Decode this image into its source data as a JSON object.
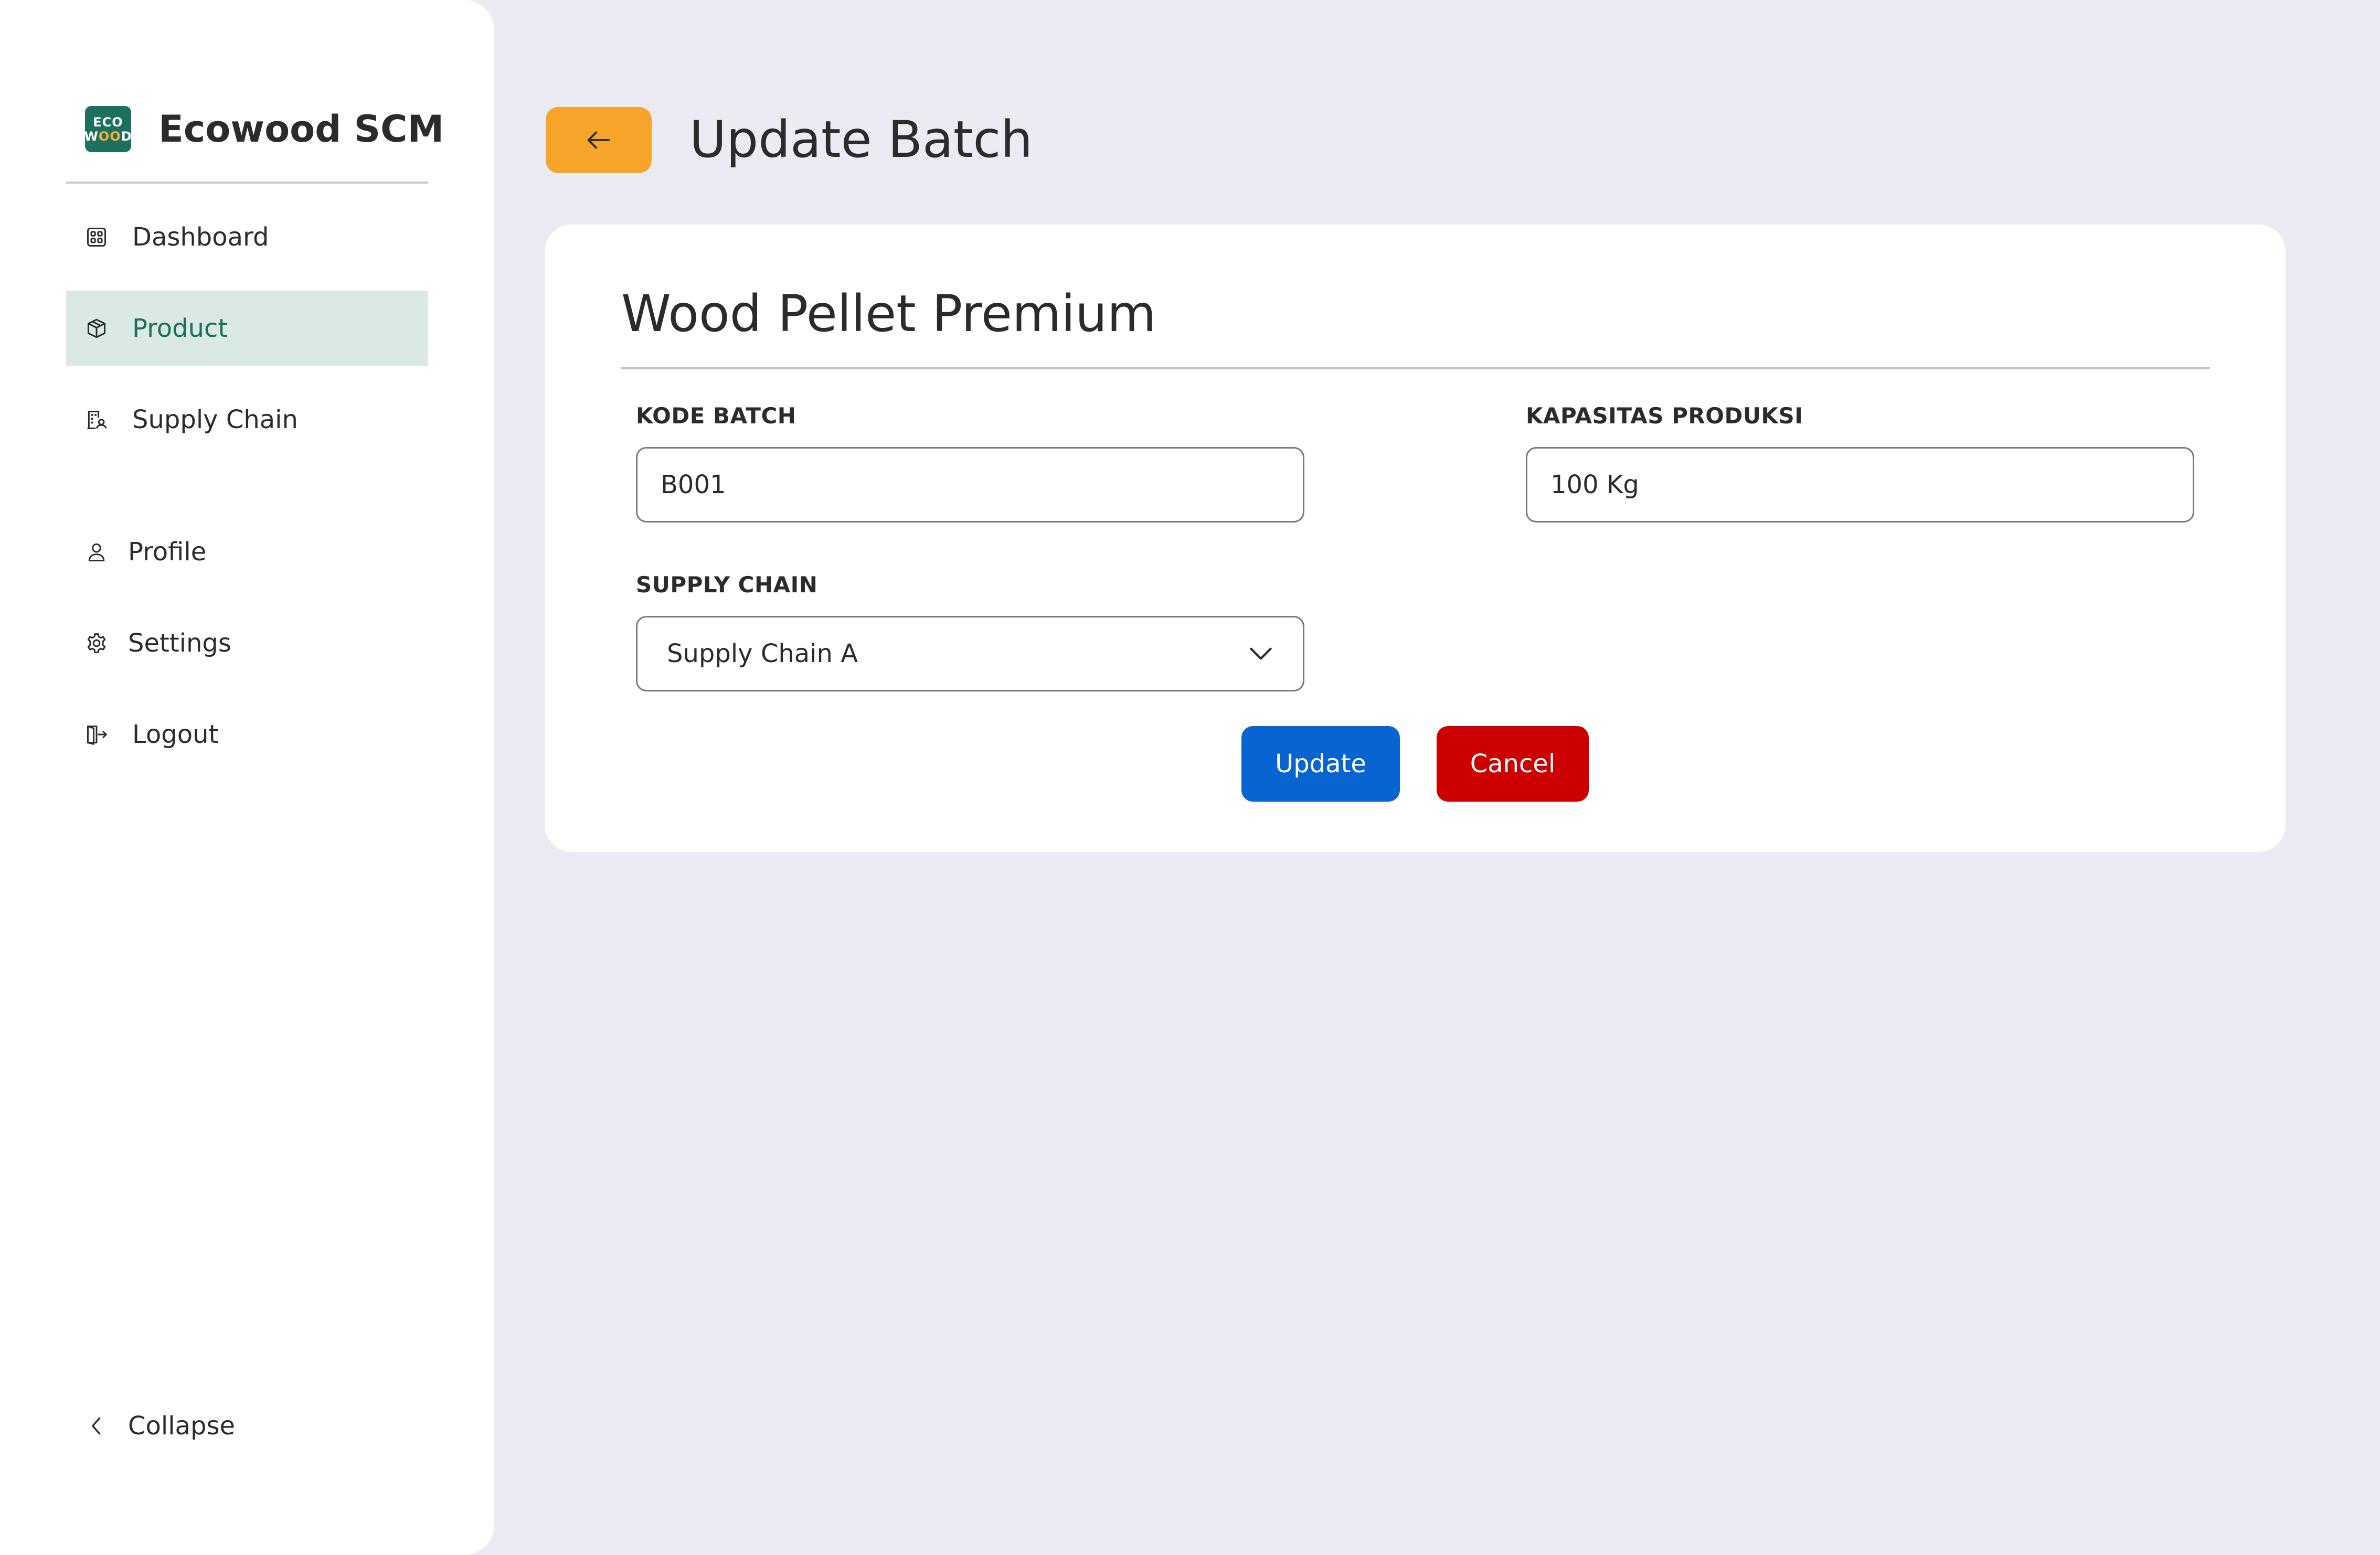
{
  "brand": {
    "logo_line1": "ECO",
    "logo_line2_a": "W",
    "logo_line2_b": "OO",
    "logo_line2_c": "D",
    "name": "Ecowood SCM"
  },
  "sidebar": {
    "items": [
      {
        "label": "Dashboard",
        "icon": "dashboard-grid-icon",
        "active": false
      },
      {
        "label": "Product",
        "icon": "box-icon",
        "active": true
      },
      {
        "label": "Supply Chain",
        "icon": "building-icon",
        "active": false
      },
      {
        "label": "Profile",
        "icon": "user-icon",
        "active": false
      },
      {
        "label": "Settings",
        "icon": "gear-icon",
        "active": false
      },
      {
        "label": "Logout",
        "icon": "logout-icon",
        "active": false
      }
    ],
    "collapse_label": "Collapse"
  },
  "header": {
    "title": "Update Batch",
    "back_icon": "arrow-left-icon"
  },
  "form": {
    "product_name": "Wood Pellet Premium",
    "kode_batch": {
      "label": "KODE BATCH",
      "value": "B001"
    },
    "kapasitas": {
      "label": "KAPASITAS PRODUKSI",
      "value": "100 Kg"
    },
    "supply_chain": {
      "label": "SUPPLY CHAIN",
      "value": "Supply Chain A"
    },
    "update_label": "Update",
    "cancel_label": "Cancel"
  },
  "colors": {
    "accent_green": "#1f6d5d",
    "active_bg": "#dbe9e5",
    "back_button": "#f7a52a",
    "update_button": "#0764d1",
    "cancel_button": "#cc0000",
    "page_bg": "#ebecf3"
  }
}
